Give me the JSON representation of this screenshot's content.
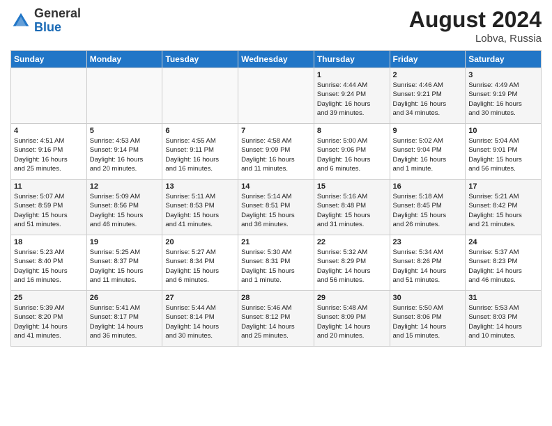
{
  "header": {
    "logo_general": "General",
    "logo_blue": "Blue",
    "month_year": "August 2024",
    "location": "Lobva, Russia"
  },
  "days_of_week": [
    "Sunday",
    "Monday",
    "Tuesday",
    "Wednesday",
    "Thursday",
    "Friday",
    "Saturday"
  ],
  "weeks": [
    [
      {
        "day": "",
        "info": ""
      },
      {
        "day": "",
        "info": ""
      },
      {
        "day": "",
        "info": ""
      },
      {
        "day": "",
        "info": ""
      },
      {
        "day": "1",
        "info": "Sunrise: 4:44 AM\nSunset: 9:24 PM\nDaylight: 16 hours\nand 39 minutes."
      },
      {
        "day": "2",
        "info": "Sunrise: 4:46 AM\nSunset: 9:21 PM\nDaylight: 16 hours\nand 34 minutes."
      },
      {
        "day": "3",
        "info": "Sunrise: 4:49 AM\nSunset: 9:19 PM\nDaylight: 16 hours\nand 30 minutes."
      }
    ],
    [
      {
        "day": "4",
        "info": "Sunrise: 4:51 AM\nSunset: 9:16 PM\nDaylight: 16 hours\nand 25 minutes."
      },
      {
        "day": "5",
        "info": "Sunrise: 4:53 AM\nSunset: 9:14 PM\nDaylight: 16 hours\nand 20 minutes."
      },
      {
        "day": "6",
        "info": "Sunrise: 4:55 AM\nSunset: 9:11 PM\nDaylight: 16 hours\nand 16 minutes."
      },
      {
        "day": "7",
        "info": "Sunrise: 4:58 AM\nSunset: 9:09 PM\nDaylight: 16 hours\nand 11 minutes."
      },
      {
        "day": "8",
        "info": "Sunrise: 5:00 AM\nSunset: 9:06 PM\nDaylight: 16 hours\nand 6 minutes."
      },
      {
        "day": "9",
        "info": "Sunrise: 5:02 AM\nSunset: 9:04 PM\nDaylight: 16 hours\nand 1 minute."
      },
      {
        "day": "10",
        "info": "Sunrise: 5:04 AM\nSunset: 9:01 PM\nDaylight: 15 hours\nand 56 minutes."
      }
    ],
    [
      {
        "day": "11",
        "info": "Sunrise: 5:07 AM\nSunset: 8:59 PM\nDaylight: 15 hours\nand 51 minutes."
      },
      {
        "day": "12",
        "info": "Sunrise: 5:09 AM\nSunset: 8:56 PM\nDaylight: 15 hours\nand 46 minutes."
      },
      {
        "day": "13",
        "info": "Sunrise: 5:11 AM\nSunset: 8:53 PM\nDaylight: 15 hours\nand 41 minutes."
      },
      {
        "day": "14",
        "info": "Sunrise: 5:14 AM\nSunset: 8:51 PM\nDaylight: 15 hours\nand 36 minutes."
      },
      {
        "day": "15",
        "info": "Sunrise: 5:16 AM\nSunset: 8:48 PM\nDaylight: 15 hours\nand 31 minutes."
      },
      {
        "day": "16",
        "info": "Sunrise: 5:18 AM\nSunset: 8:45 PM\nDaylight: 15 hours\nand 26 minutes."
      },
      {
        "day": "17",
        "info": "Sunrise: 5:21 AM\nSunset: 8:42 PM\nDaylight: 15 hours\nand 21 minutes."
      }
    ],
    [
      {
        "day": "18",
        "info": "Sunrise: 5:23 AM\nSunset: 8:40 PM\nDaylight: 15 hours\nand 16 minutes."
      },
      {
        "day": "19",
        "info": "Sunrise: 5:25 AM\nSunset: 8:37 PM\nDaylight: 15 hours\nand 11 minutes."
      },
      {
        "day": "20",
        "info": "Sunrise: 5:27 AM\nSunset: 8:34 PM\nDaylight: 15 hours\nand 6 minutes."
      },
      {
        "day": "21",
        "info": "Sunrise: 5:30 AM\nSunset: 8:31 PM\nDaylight: 15 hours\nand 1 minute."
      },
      {
        "day": "22",
        "info": "Sunrise: 5:32 AM\nSunset: 8:29 PM\nDaylight: 14 hours\nand 56 minutes."
      },
      {
        "day": "23",
        "info": "Sunrise: 5:34 AM\nSunset: 8:26 PM\nDaylight: 14 hours\nand 51 minutes."
      },
      {
        "day": "24",
        "info": "Sunrise: 5:37 AM\nSunset: 8:23 PM\nDaylight: 14 hours\nand 46 minutes."
      }
    ],
    [
      {
        "day": "25",
        "info": "Sunrise: 5:39 AM\nSunset: 8:20 PM\nDaylight: 14 hours\nand 41 minutes."
      },
      {
        "day": "26",
        "info": "Sunrise: 5:41 AM\nSunset: 8:17 PM\nDaylight: 14 hours\nand 36 minutes."
      },
      {
        "day": "27",
        "info": "Sunrise: 5:44 AM\nSunset: 8:14 PM\nDaylight: 14 hours\nand 30 minutes."
      },
      {
        "day": "28",
        "info": "Sunrise: 5:46 AM\nSunset: 8:12 PM\nDaylight: 14 hours\nand 25 minutes."
      },
      {
        "day": "29",
        "info": "Sunrise: 5:48 AM\nSunset: 8:09 PM\nDaylight: 14 hours\nand 20 minutes."
      },
      {
        "day": "30",
        "info": "Sunrise: 5:50 AM\nSunset: 8:06 PM\nDaylight: 14 hours\nand 15 minutes."
      },
      {
        "day": "31",
        "info": "Sunrise: 5:53 AM\nSunset: 8:03 PM\nDaylight: 14 hours\nand 10 minutes."
      }
    ]
  ]
}
